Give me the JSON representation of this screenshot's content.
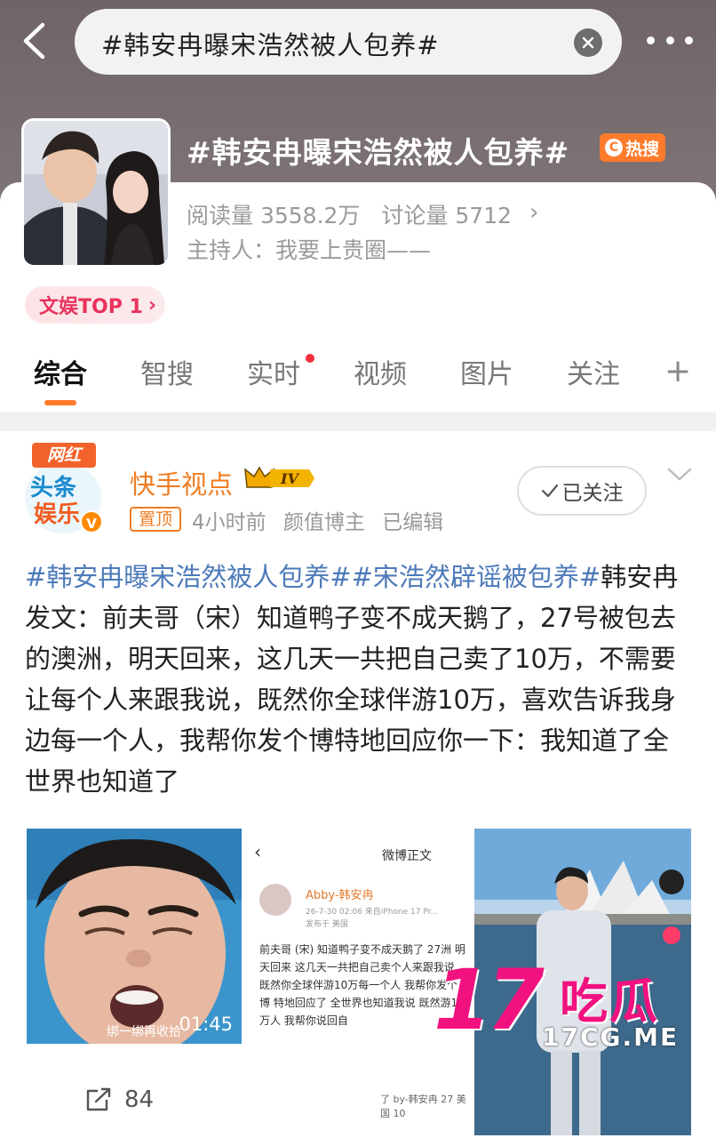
{
  "search": {
    "query": "#韩安冉曝宋浩然被人包养#"
  },
  "topic": {
    "title": "#韩安冉曝宋浩然被人包养#",
    "hot_badge": "热搜",
    "reads": "阅读量 3558.2万",
    "discussions": "讨论量 5712",
    "host": "主持人：我要上贵圈——",
    "rank": "文娱TOP 1"
  },
  "tabs": [
    "综合",
    "智搜",
    "实时",
    "视频",
    "图片",
    "关注"
  ],
  "post": {
    "avatar_tag": "网红",
    "avatar_line1": "头条",
    "avatar_line2": "娱乐",
    "author": "快手视点",
    "level": "IV",
    "pin_tag": "置顶",
    "time": "4小时前",
    "category": "颜值博主",
    "edited": "已编辑",
    "follow_label": "已关注",
    "hashtags": "#韩安冉曝宋浩然被人包养##宋浩然辟谣被包养#",
    "body": "韩安冉发文：前夫哥（宋）知道鸭子变不成天鹅了，27号被包去的澳洲，明天回来，这几天一共把自己卖了10万，不需要让每个人来跟我说，既然你全球伴游10万，喜欢告诉我身边每一个人，我帮你发个博特地回应你一下：我知道了全世界也知道了",
    "video_duration": "01:45",
    "video_caption": "绑一绑再收拾",
    "share_count": "84"
  },
  "screenshot": {
    "header": "微博正文",
    "user": "Abby-韩安冉",
    "time": "26-7-30 02:06  来自iPhone 17 Pr...",
    "location": "发布于 美国",
    "text": "前夫哥 (宋) 知道鸭子变不成天鹅了 27洲 明天回来 这几天一共把自己卖个人来跟我说 既然你全球伴游10万每一个人 我帮你发个博 特地回应了 全世界也知道我说 既然游10万人 我帮你说回自",
    "bottom": "了 by-韩安冉 27 美国 10"
  },
  "watermark": {
    "big": "17",
    "cn": "吃瓜",
    "url": "17CG.ME"
  },
  "colors": {
    "accent": "#ff7b2c",
    "hashtag": "#4d7ab9",
    "author": "#f07d22",
    "watermark": "#f1127f"
  }
}
